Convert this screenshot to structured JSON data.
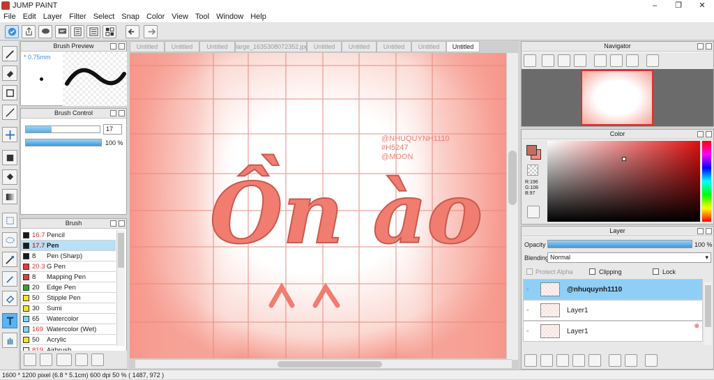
{
  "window": {
    "title": "JUMP PAINT",
    "min": "–",
    "max": "❐",
    "close": "✕"
  },
  "menu": [
    "File",
    "Edit",
    "Layer",
    "Filter",
    "Select",
    "Snap",
    "Color",
    "View",
    "Tool",
    "Window",
    "Help"
  ],
  "tabs": [
    "Untitled",
    "Untitled",
    "Untitled",
    "large_1635308072352.jpg",
    "Untitled",
    "Untitled",
    "Untitled",
    "Untitled",
    "Untitled"
  ],
  "active_tab_index": 8,
  "brush_preview": {
    "title": "Brush Preview",
    "size": "* 0.75mm"
  },
  "brush_control": {
    "title": "Brush Control",
    "size_value": "17",
    "opacity_value": "100 %",
    "size_fraction": 0.35,
    "opacity_fraction": 1.0
  },
  "brush": {
    "title": "Brush",
    "items": [
      {
        "num": "16.7",
        "name": "Pencil",
        "color": "#1a1a1a",
        "num_red": true
      },
      {
        "num": "17.7",
        "name": "Pen",
        "color": "#1a1a1a",
        "num_red": true,
        "selected": true
      },
      {
        "num": "8",
        "name": "Pen (Sharp)",
        "color": "#1a1a1a",
        "num_red": false
      },
      {
        "num": "20.3",
        "name": "G Pen",
        "color": "#e23b3b",
        "num_red": true
      },
      {
        "num": "8",
        "name": "Mapping Pen",
        "color": "#e23b3b",
        "num_red": false
      },
      {
        "num": "20",
        "name": "Edge Pen",
        "color": "#2aa832",
        "num_red": false
      },
      {
        "num": "50",
        "name": "Stipple Pen",
        "color": "#f2e232",
        "num_red": false
      },
      {
        "num": "30",
        "name": "Sumi",
        "color": "#f2e232",
        "num_red": false
      },
      {
        "num": "65",
        "name": "Watercolor",
        "color": "#7fd4f2",
        "num_red": false
      },
      {
        "num": "169",
        "name": "Watercolor (Wet)",
        "color": "#7fd4f2",
        "num_red": true
      },
      {
        "num": "50",
        "name": "Acrylic",
        "color": "#f2e232",
        "num_red": false
      },
      {
        "num": "819",
        "name": "Airbrush",
        "color": "#f5f5f5",
        "num_red": true
      }
    ]
  },
  "navigator": {
    "title": "Navigator"
  },
  "color": {
    "title": "Color",
    "r": "R:196",
    "g": "G:108",
    "b": "B:97",
    "main_color": "#c46c61"
  },
  "layer": {
    "title": "Layer",
    "opacity_label": "Opacity",
    "opacity_value": "100 %",
    "blending_label": "Blending",
    "blending_value": "Normal",
    "protect_alpha": "Protect Alpha",
    "clipping": "Clipping",
    "lock": "Lock",
    "layers": [
      {
        "name": "@nhuquynh1110",
        "selected": true
      },
      {
        "name": "Layer1",
        "selected": false
      },
      {
        "name": "Layer1",
        "selected": false
      }
    ]
  },
  "canvas_text": {
    "watermark_lines": [
      "@NHUQUYNH1110",
      "#H5247",
      "@MOON"
    ],
    "main_text": "Ồn ào",
    "accent": "#f07d70"
  },
  "status": "1600 * 1200 pixel   (6.8 * 5.1cm)   600 dpi   50 %   ( 1487, 972 )"
}
